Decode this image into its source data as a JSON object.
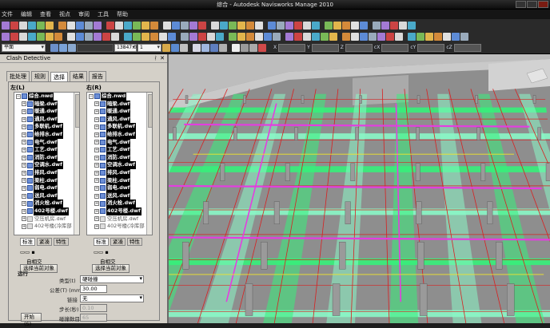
{
  "window": {
    "title": "综合 - Autodesk Navisworks Manage 2010"
  },
  "menu": [
    "文件",
    "编辑",
    "查看",
    "视点",
    "审阅",
    "工具",
    "帮助"
  ],
  "toolbar": {
    "view_select": "平面",
    "zoom_value": "13847.0",
    "step_value": "1",
    "coord_labels": [
      "X",
      "Y",
      "Z",
      "cX",
      "cY",
      "cZ"
    ]
  },
  "panel": {
    "title": "Clash Detective",
    "pin": "ᚰ",
    "close": "✕",
    "tabs": [
      "批处理",
      "规则",
      "选择",
      "结果",
      "报告"
    ],
    "active_tab": "选择",
    "left_group": "左(L)",
    "right_group": "右(R)",
    "tree_items": [
      {
        "label": "综合.nwd",
        "bold": true
      },
      {
        "label": "暗梁.dwf",
        "bold": true
      },
      {
        "label": "暖通.dwf",
        "bold": true
      },
      {
        "label": "通风.dwf",
        "bold": true
      },
      {
        "label": "多联机.dwf",
        "bold": true
      },
      {
        "label": "给排水.dwf",
        "bold": true
      },
      {
        "label": "电气.dwf",
        "bold": true
      },
      {
        "label": "工艺.dwf",
        "bold": true
      },
      {
        "label": "消防.dwf",
        "bold": true
      },
      {
        "label": "空调水.dwf",
        "bold": true
      },
      {
        "label": "排风.dwf",
        "bold": true
      },
      {
        "label": "梁柱.dwf",
        "bold": true
      },
      {
        "label": "弱电.dwf",
        "bold": true
      },
      {
        "label": "送风.dwf",
        "bold": true
      },
      {
        "label": "消火栓.dwf",
        "bold": true
      },
      {
        "label": "402号楼.dwf",
        "bold": true
      },
      {
        "label": "空压机房.dwf",
        "bold": false
      },
      {
        "label": "402号楼(冷库部",
        "bold": false
      }
    ],
    "subtabs": [
      "标准",
      "紧凑",
      "特性"
    ],
    "self_intersect": "自相交",
    "select_current": "选择当前对象",
    "run": {
      "section": "运行",
      "type_label": "类型(t)",
      "type_value": "硬碰撞",
      "tolerance_label": "公差(T) (mm)",
      "tolerance_value": "30.00",
      "link_label": "链接",
      "link_value": "无",
      "step_label": "步长(秒)",
      "step_value": "0.10",
      "run_button": "开始(S)",
      "count_label": "碰撞数目",
      "count_value": "65"
    }
  },
  "colors": {
    "pipe_green": "#36f07a",
    "pipe_mint": "#8af7c6",
    "magenta": "#e43de0",
    "red_line": "#d82020",
    "structure_grey": "#9a9a9a",
    "yellow": "#f2e629"
  }
}
